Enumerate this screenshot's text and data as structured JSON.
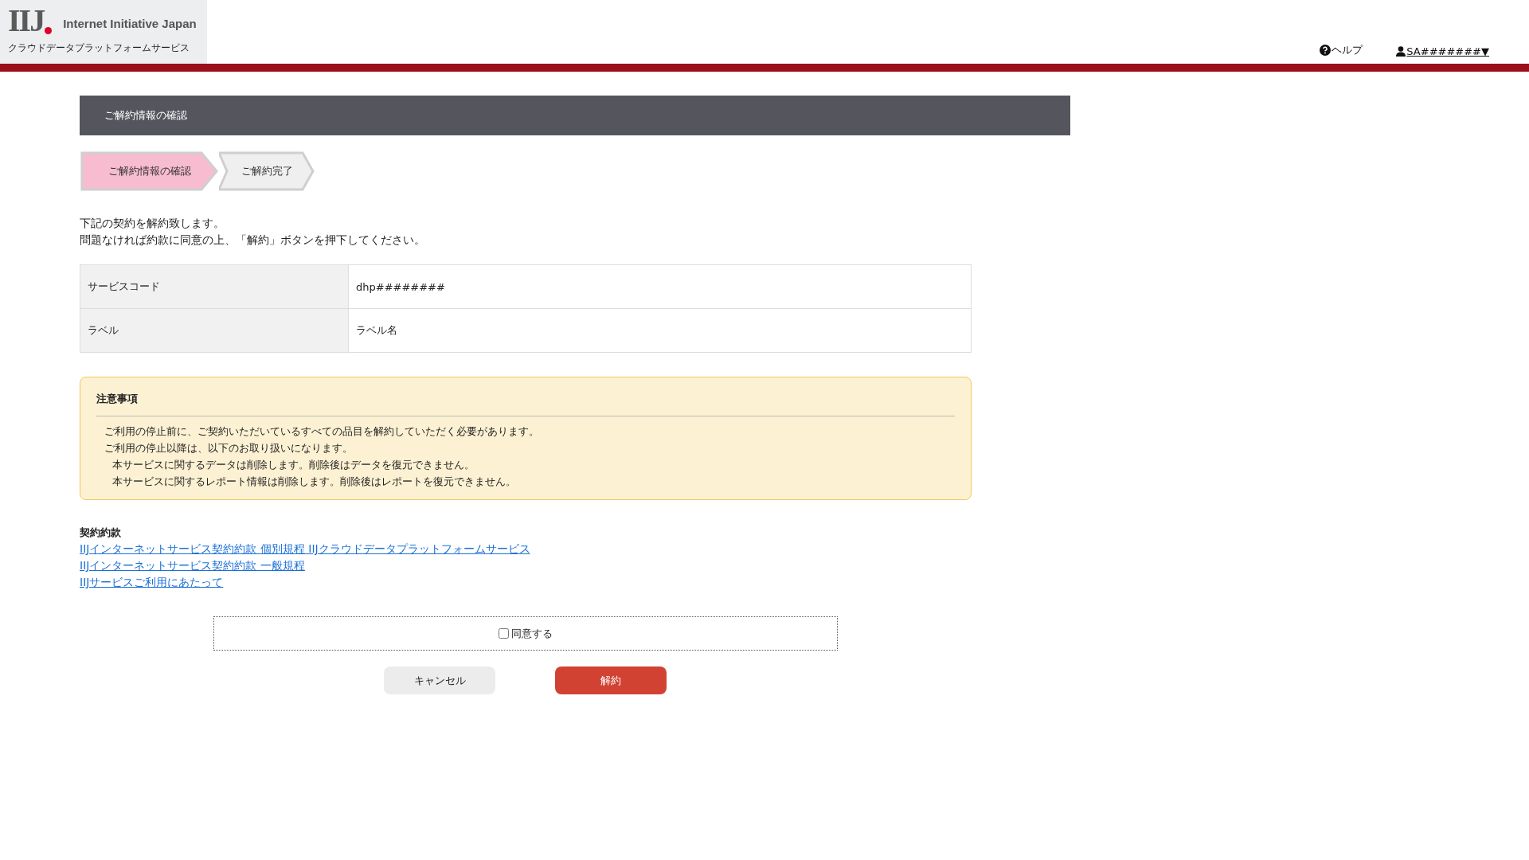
{
  "header": {
    "logo_mark": "IIJ",
    "logo_text": "Internet Initiative Japan",
    "service_name": "クラウドデータプラットフォームサービス",
    "help": "ヘルプ",
    "user": "SA#######▼"
  },
  "page_title": "ご解約情報の確認",
  "steps": [
    {
      "label": "ご解約情報の確認",
      "selected": true
    },
    {
      "label": "ご解約完了",
      "selected": false
    }
  ],
  "intro": [
    "下記の契約を解約致します。",
    "問題なければ約款に同意の上、「解約」ボタンを押下してください。"
  ],
  "details": [
    {
      "label": "サービスコード",
      "value": "dhp########"
    },
    {
      "label": "ラベル",
      "value": "ラベル名"
    }
  ],
  "notice": {
    "title": "注意事項",
    "lines": [
      {
        "text": "ご利用の停止前に、ご契約いただいているすべての品目を解約していただく必要があります。"
      },
      {
        "text": "ご利用の停止以降は、以下のお取り扱いになります。",
        "children": [
          "本サービスに関するデータは削除します。削除後はデータを復元できません。",
          "本サービスに関するレポート情報は削除します。削除後はレポートを復元できません。"
        ]
      }
    ]
  },
  "terms": {
    "title": "契約約款",
    "links": [
      "IIJインターネットサービス契約約款 個別規程 IIJクラウドデータプラットフォームサービス",
      "IIJインターネットサービス契約約款 一般規程",
      "IIJサービスご利用にあたって"
    ]
  },
  "agree": {
    "label": "同意する",
    "checked": false
  },
  "buttons": [
    {
      "label": "キャンセル",
      "kind": "secondary"
    },
    {
      "label": "解約",
      "kind": "danger"
    }
  ]
}
